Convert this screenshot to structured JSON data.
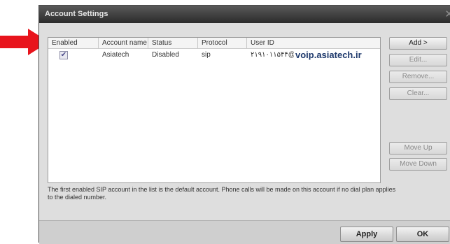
{
  "dialog": {
    "title": "Account Settings",
    "close_glyph": "✕"
  },
  "columns": [
    "Enabled",
    "Account name",
    "Status",
    "Protocol",
    "User ID"
  ],
  "accounts": [
    {
      "enabled": true,
      "name": "Asiatech",
      "status": "Disabled",
      "protocol": "sip",
      "user_id_number": "۲۱۹۱۰۱۱۵۴۴",
      "user_id_at": "@",
      "user_id_domain": "voip.asiatech.ir"
    }
  ],
  "buttons": {
    "add": "Add >",
    "edit": "Edit...",
    "remove": "Remove...",
    "clear": "Clear...",
    "move_up": "Move Up",
    "move_down": "Move Down"
  },
  "info_text": "The first enabled SIP account in the list is the default account. Phone calls will be made on this account if no dial plan applies to the dialed number.",
  "footer": {
    "apply": "Apply",
    "ok": "OK"
  },
  "colors": {
    "arrow": "#e8141c",
    "title_bar": "#3a3a3a",
    "dialog_bg": "#dedede"
  },
  "icons": {
    "annotation": "red-arrow-icon",
    "check": "checkbox-checked-icon"
  }
}
